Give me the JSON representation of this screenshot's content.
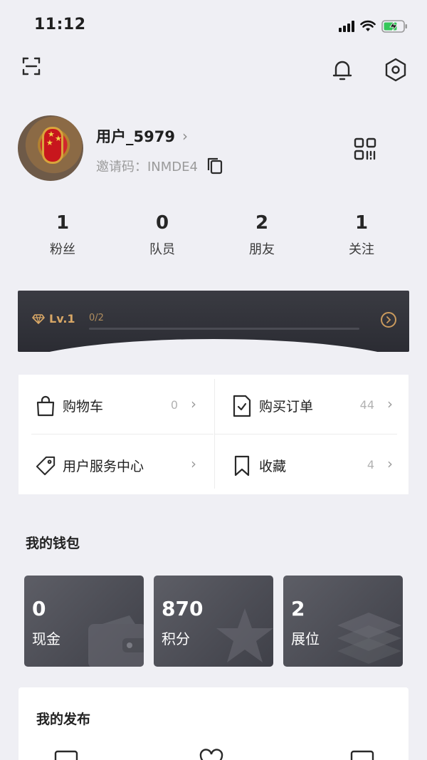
{
  "status_bar": {
    "time": "11:12"
  },
  "profile": {
    "username": "用户_5979",
    "invite_label": "邀请码：",
    "invite_code": "INMDE4"
  },
  "stats": [
    {
      "value": "1",
      "label": "粉丝"
    },
    {
      "value": "0",
      "label": "队员"
    },
    {
      "value": "2",
      "label": "朋友"
    },
    {
      "value": "1",
      "label": "关注"
    }
  ],
  "level": {
    "label": "Lv.1",
    "progress_text": "0/2",
    "progress_fraction": 0.0
  },
  "menu": [
    {
      "label": "购物车",
      "count": "0",
      "icon": "shopping-bag-icon"
    },
    {
      "label": "购买订单",
      "count": "44",
      "icon": "order-check-icon"
    },
    {
      "label": "用户服务中心",
      "count": "",
      "icon": "tag-icon"
    },
    {
      "label": "收藏",
      "count": "4",
      "icon": "bookmark-icon"
    }
  ],
  "wallet": {
    "title": "我的钱包",
    "items": [
      {
        "value": "0",
        "label": "现金",
        "icon": "wallet-icon"
      },
      {
        "value": "870",
        "label": "积分",
        "icon": "star-icon"
      },
      {
        "value": "2",
        "label": "展位",
        "icon": "layers-icon"
      }
    ]
  },
  "publish": {
    "title": "我的发布"
  },
  "colors": {
    "background": "#efeff4",
    "level_gold": "#d8a766",
    "card_dark": "#3f4048"
  }
}
